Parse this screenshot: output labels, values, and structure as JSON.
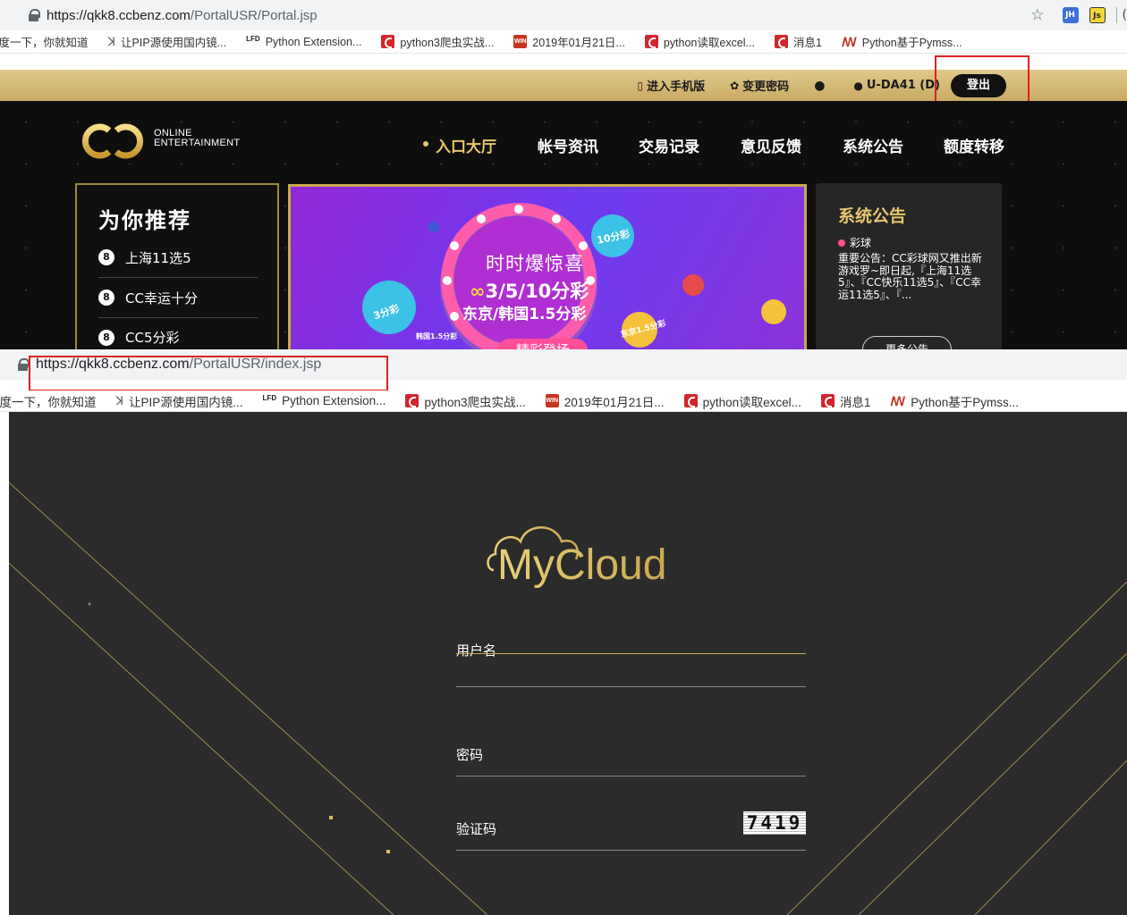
{
  "portal_shot": {
    "url_host": "https://qkk8.ccbenz.com",
    "url_path": "/PortalUSR/Portal.jsp",
    "extensions": [
      "JH",
      "Js"
    ],
    "bookmarks": [
      {
        "icon": "baidu-icon",
        "label": "百度一下，你就知道"
      },
      {
        "icon": "pip-icon",
        "label": "让PIP源使用国内镜..."
      },
      {
        "icon": "lfd-icon",
        "label": "Python Extension..."
      },
      {
        "icon": "csdn-icon",
        "label": "python3爬虫实战..."
      },
      {
        "icon": "win-icon",
        "label": "2019年01月21日..."
      },
      {
        "icon": "csdn-icon",
        "label": "python读取excel..."
      },
      {
        "icon": "csdn-icon",
        "label": "消息1"
      },
      {
        "icon": "pycharm-icon",
        "label": "Python基于Pymss..."
      }
    ],
    "user_bar": {
      "mobile": "进入手机版",
      "change_pwd": "变更密码",
      "user": "U-DA41 (D)",
      "logout": "登出"
    },
    "logo_text_1": "ONLINE",
    "logo_text_2": "ENTERTAINMENT",
    "nav": [
      "入口大厅",
      "帐号资讯",
      "交易记录",
      "意见反馈",
      "系统公告",
      "额度转移"
    ],
    "recommend": {
      "title": "为你推荐",
      "items": [
        "上海11选5",
        "CC幸运十分",
        "CC5分彩"
      ]
    },
    "banner": {
      "headline": "时时爆惊喜",
      "line1": "3/5/10分彩",
      "line2": "东京/韩国1.5分彩",
      "button": "精彩登场",
      "badge_10": "10分彩",
      "badge_3": "3分彩",
      "badge_15": "东京1.5分彩",
      "badge_kr": "韩国1.5分彩"
    },
    "notice": {
      "title": "系统公告",
      "category": "彩球",
      "body": "重要公告：CC彩球网又推出新游戏罗~即日起,『上海11选5』、『CC快乐11选5』、『CC幸运11选5』、『...",
      "more": "更多公告"
    },
    "colors": {
      "gold": "#e8c66f",
      "highlight_red": "#e02020"
    }
  },
  "login_shot": {
    "url_host": "https://qkk8.ccbenz.com",
    "url_path": "/PortalUSR/index.jsp",
    "bookmarks": [
      {
        "icon": "baidu-icon",
        "label": "百度一下，你就知道"
      },
      {
        "icon": "pip-icon",
        "label": "让PIP源使用国内镜..."
      },
      {
        "icon": "lfd-icon",
        "label": "Python Extension..."
      },
      {
        "icon": "csdn-icon",
        "label": "python3爬虫实战..."
      },
      {
        "icon": "win-icon",
        "label": "2019年01月21日..."
      },
      {
        "icon": "csdn-icon",
        "label": "python读取excel..."
      },
      {
        "icon": "csdn-icon",
        "label": "消息1"
      },
      {
        "icon": "pycharm-icon",
        "label": "Python基于Pymss..."
      }
    ],
    "logo": "MyCloud",
    "form": {
      "username_label": "用户名",
      "username_value": "",
      "password_label": "密码",
      "password_value": "",
      "captcha_label": "验证码",
      "captcha_value": "",
      "captcha_image": "7419"
    }
  }
}
